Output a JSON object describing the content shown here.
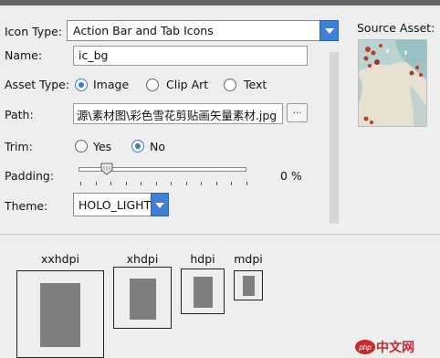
{
  "form": {
    "icon_type_label": "Icon Type:",
    "icon_type_value": "Action Bar and Tab Icons",
    "name_label": "Name:",
    "name_value": "ic_bg",
    "asset_type_label": "Asset Type:",
    "asset_type_options": [
      "Image",
      "Clip Art",
      "Text"
    ],
    "asset_type_selected": "Image",
    "path_label": "Path:",
    "path_value": "源\\素材图\\彩色雪花剪贴画矢量素材.jpg",
    "browse_label": "...",
    "trim_label": "Trim:",
    "trim_options": [
      "Yes",
      "No"
    ],
    "trim_selected": "No",
    "padding_label": "Padding:",
    "padding_value": 0,
    "padding_text": "0 %",
    "theme_label": "Theme:",
    "theme_value": "HOLO_LIGHT"
  },
  "source_asset": {
    "label": "Source Asset:"
  },
  "previews": [
    {
      "label": "xxhdpi"
    },
    {
      "label": "xhdpi"
    },
    {
      "label": "hdpi"
    },
    {
      "label": "mdpi"
    }
  ],
  "watermark": {
    "text": "中文网",
    "icon_text": "php"
  },
  "colors": {
    "accent": "#3f7fd6",
    "radio_checked": "#3a7bd5",
    "preview_fill": "#7f7f7f"
  }
}
